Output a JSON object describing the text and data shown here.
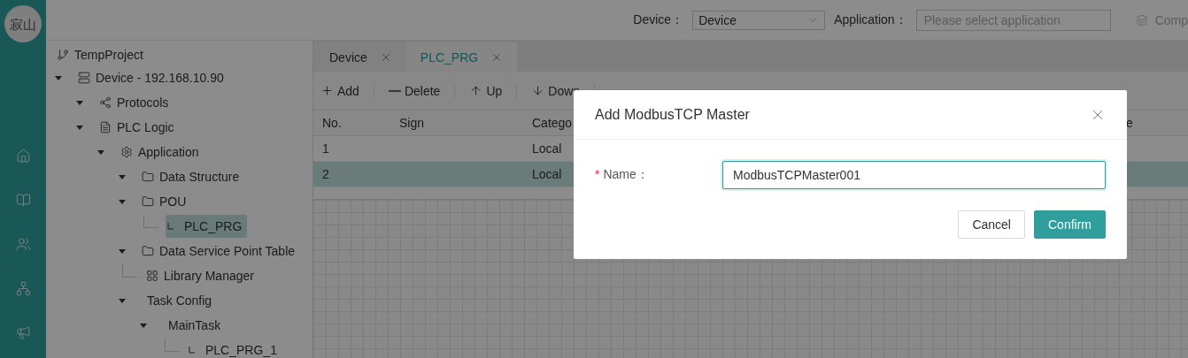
{
  "logo": {
    "text": "寂山"
  },
  "rail": {
    "items": [
      {
        "kind": "home"
      },
      {
        "kind": "book"
      },
      {
        "kind": "users"
      },
      {
        "kind": "network"
      },
      {
        "kind": "megaphone"
      }
    ]
  },
  "topbar": {
    "device_label": "Device：",
    "device_select": {
      "value": "Device"
    },
    "application_label": "Application：",
    "application_field": {
      "placeholder": "Please select application"
    },
    "compile_button": "Comp"
  },
  "tree": {
    "label": "TempProject",
    "kind": "project",
    "children": [
      {
        "label": "Device - 192.168.10.90",
        "kind": "device",
        "expanded": true,
        "selected": false,
        "children": [
          {
            "label": "Protocols",
            "kind": "protocols",
            "expanded": true,
            "selected": false
          },
          {
            "label": "PLC Logic",
            "kind": "logic",
            "expanded": true,
            "selected": false,
            "children": [
              {
                "label": "Application",
                "kind": "application",
                "expanded": true,
                "selected": false,
                "children": [
                  {
                    "label": "Data Structure",
                    "kind": "folder",
                    "expanded": true,
                    "selected": false
                  },
                  {
                    "label": "POU",
                    "kind": "folder",
                    "expanded": true,
                    "selected": false,
                    "children": [
                      {
                        "label": "PLC_PRG",
                        "kind": "program",
                        "selected": true
                      }
                    ]
                  },
                  {
                    "label": "Data Service Point Table",
                    "kind": "folder",
                    "expanded": true,
                    "selected": false
                  },
                  {
                    "label": "Library Manager",
                    "kind": "library",
                    "selected": false
                  },
                  {
                    "label": "Task Config",
                    "kind": "task",
                    "expanded": true,
                    "selected": false,
                    "children": [
                      {
                        "label": "MainTask",
                        "kind": "task",
                        "expanded": true,
                        "selected": false,
                        "children": [
                          {
                            "label": "PLC_PRG_1",
                            "kind": "program",
                            "selected": false
                          }
                        ]
                      }
                    ]
                  }
                ]
              }
            ]
          }
        ]
      }
    ]
  },
  "tabs": [
    {
      "label": "Device",
      "selected": false
    },
    {
      "label": "PLC_PRG",
      "selected": true
    }
  ],
  "toolbar": [
    {
      "kind": "add",
      "label": "Add"
    },
    {
      "kind": "delete",
      "label": "Delete"
    },
    {
      "kind": "up",
      "label": "Up"
    },
    {
      "kind": "down",
      "label": "Down"
    }
  ],
  "table": {
    "columns": [
      "No.",
      "Sign",
      "Catego",
      "e"
    ],
    "rows": [
      {
        "cells": [
          "1",
          "",
          "Local"
        ],
        "selected": false
      },
      {
        "cells": [
          "2",
          "",
          "Local"
        ],
        "selected": true
      }
    ]
  },
  "dialog": {
    "title": "Add ModbusTCP Master",
    "required_mark": "*",
    "field_label": "Name：",
    "field_value": "ModbusTCPMaster001",
    "buttons": [
      {
        "kind": "secondary",
        "label": "Cancel"
      },
      {
        "kind": "primary",
        "label": "Confirm"
      }
    ]
  }
}
